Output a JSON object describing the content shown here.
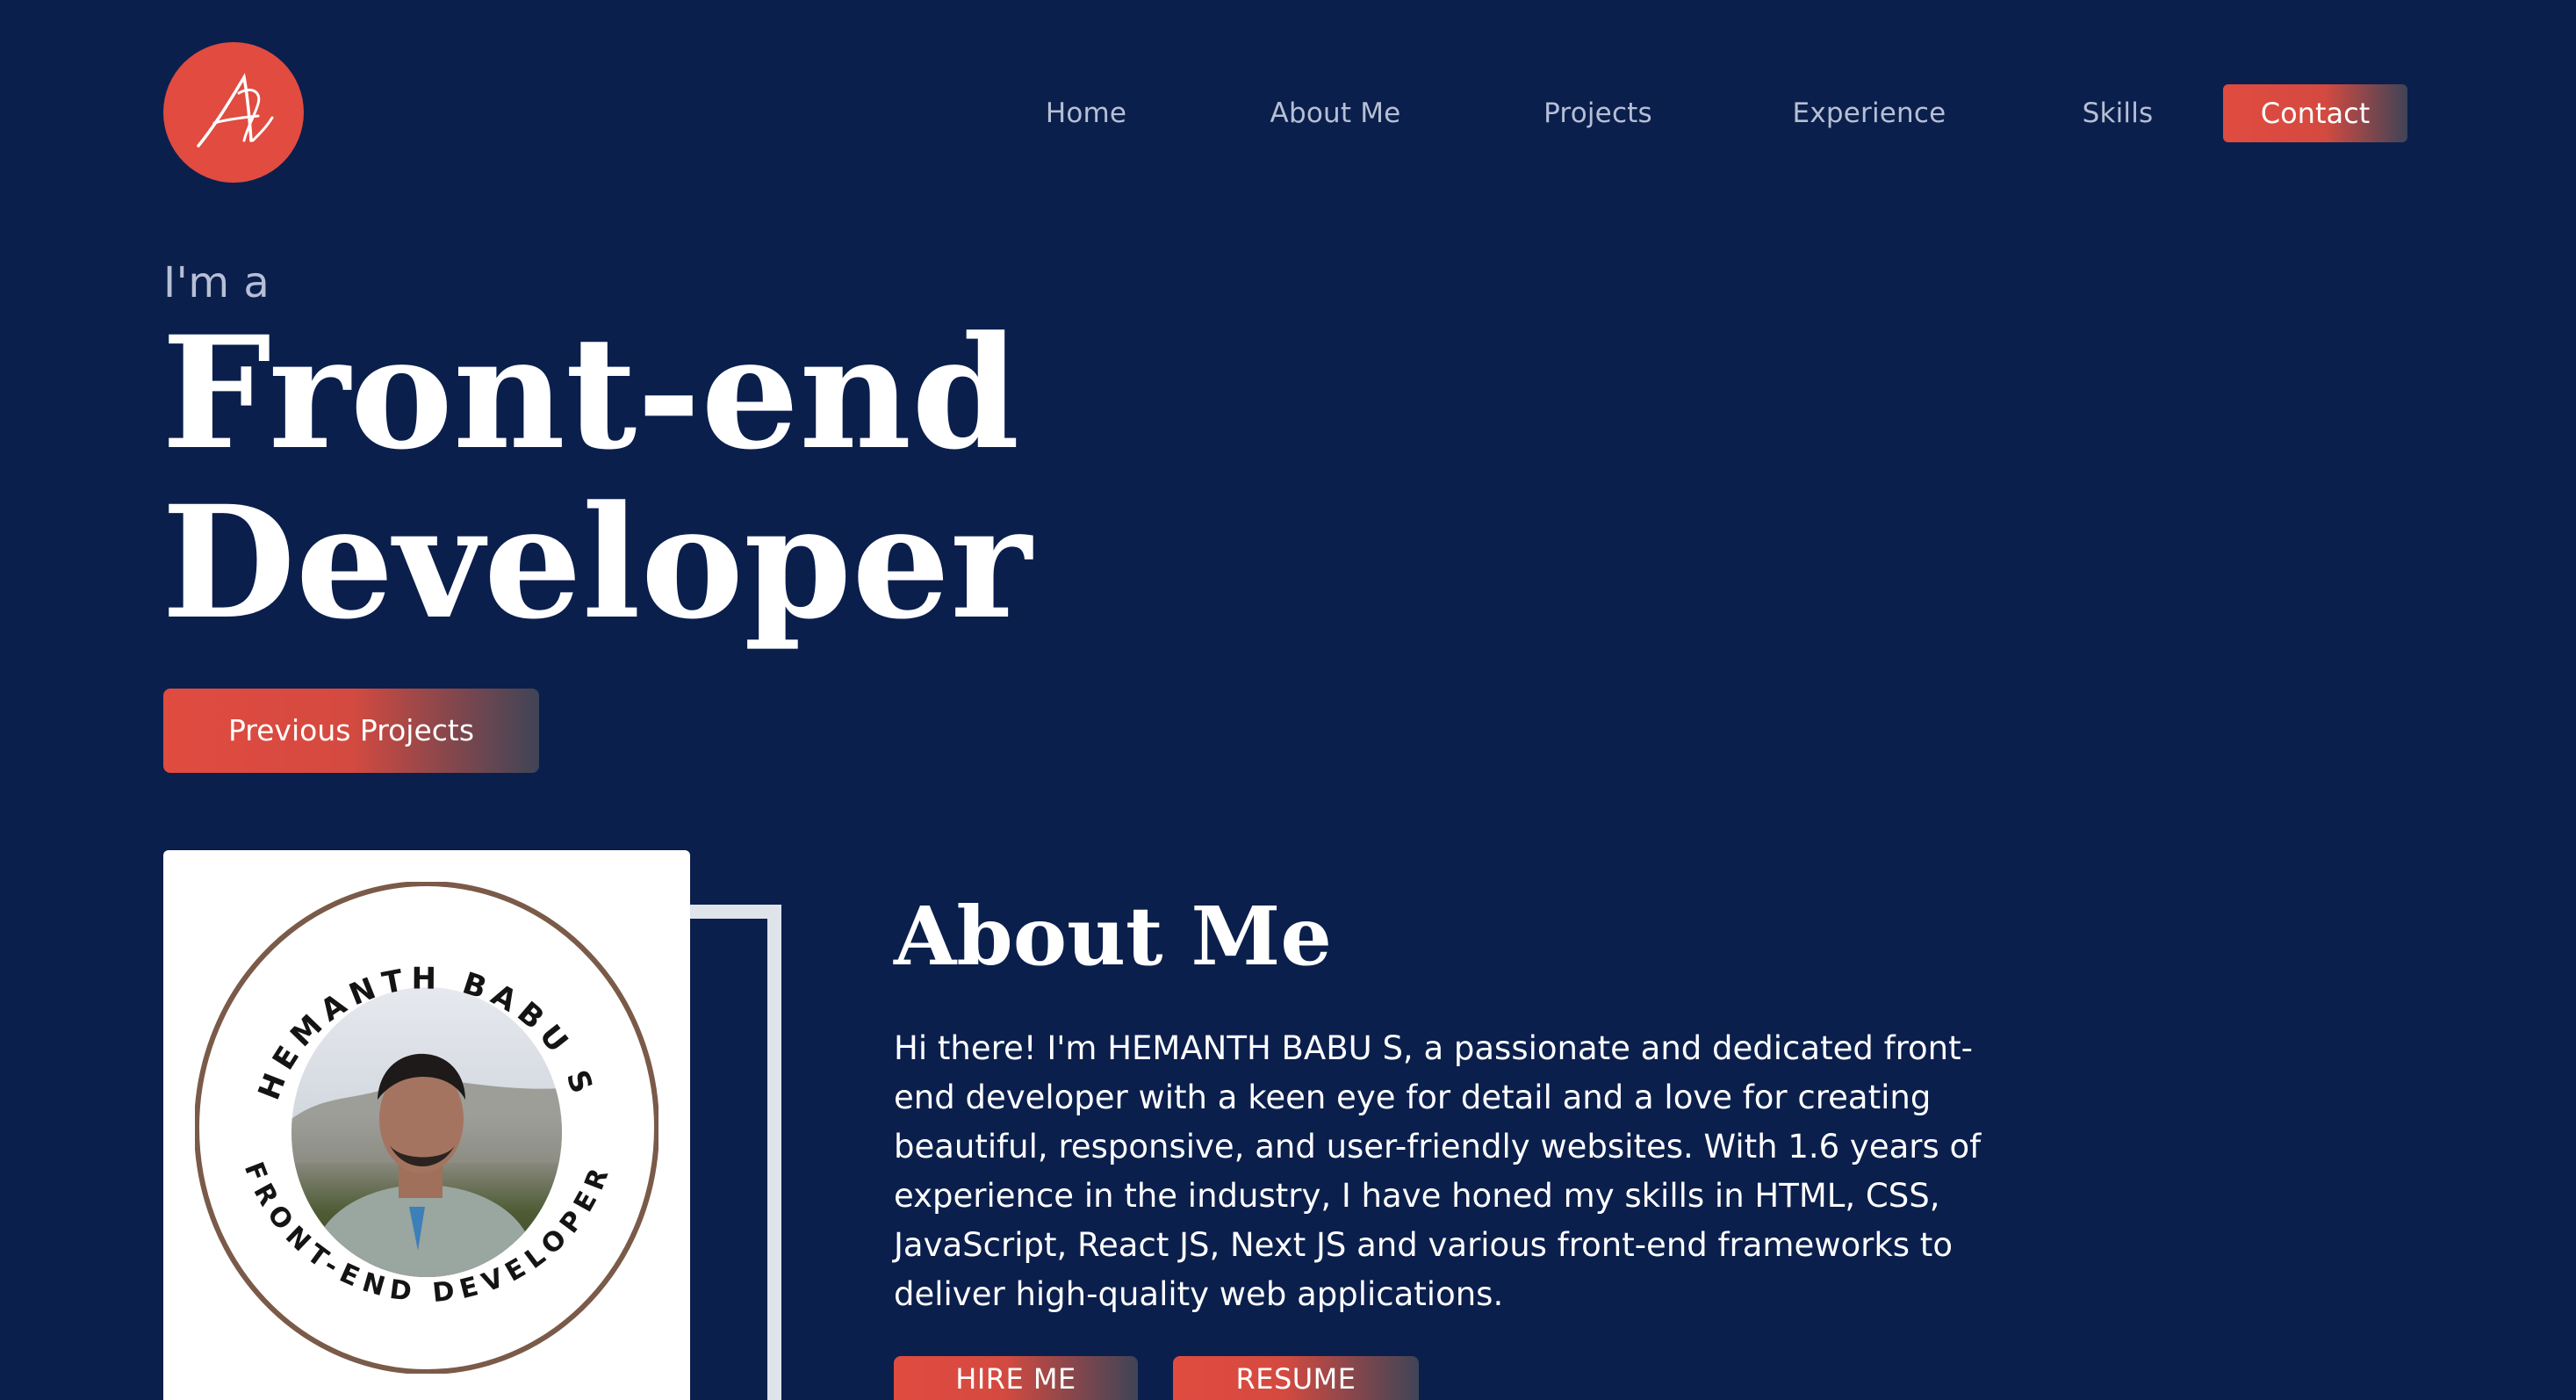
{
  "header": {
    "logo_icon": "signature-logo-icon",
    "logo_color": "#e14b40",
    "nav": {
      "home": "Home",
      "about": "About Me",
      "projects": "Projects",
      "experience": "Experience",
      "skills": "Skills",
      "contact": "Contact"
    }
  },
  "hero": {
    "intro": "I'm a",
    "title_line1": "Front-end",
    "title_line2": "Developer",
    "cta_label": "Previous Projects"
  },
  "profile": {
    "badge_top_text": "HEMANTH BABU S",
    "badge_bottom_text": "FRONT-END DEVELOPER",
    "ring_color": "#7a5a48",
    "photo_icon": "profile-photo"
  },
  "about": {
    "title": "About Me",
    "description": "Hi there! I'm HEMANTH BABU S, a passionate and dedicated front-end developer with a keen eye for detail and a love for creating beautiful, responsive, and user-friendly websites. With 1.6 years of experience in the industry, I have honed my skills in HTML, CSS, JavaScript, React JS, Next JS and various front-end frameworks to deliver high-quality web applications.",
    "hire_label": "HIRE ME",
    "resume_label": "RESUME"
  },
  "colors": {
    "background": "#0b1f4d",
    "accent": "#e14b40",
    "nav_text": "#b6bfd4"
  }
}
